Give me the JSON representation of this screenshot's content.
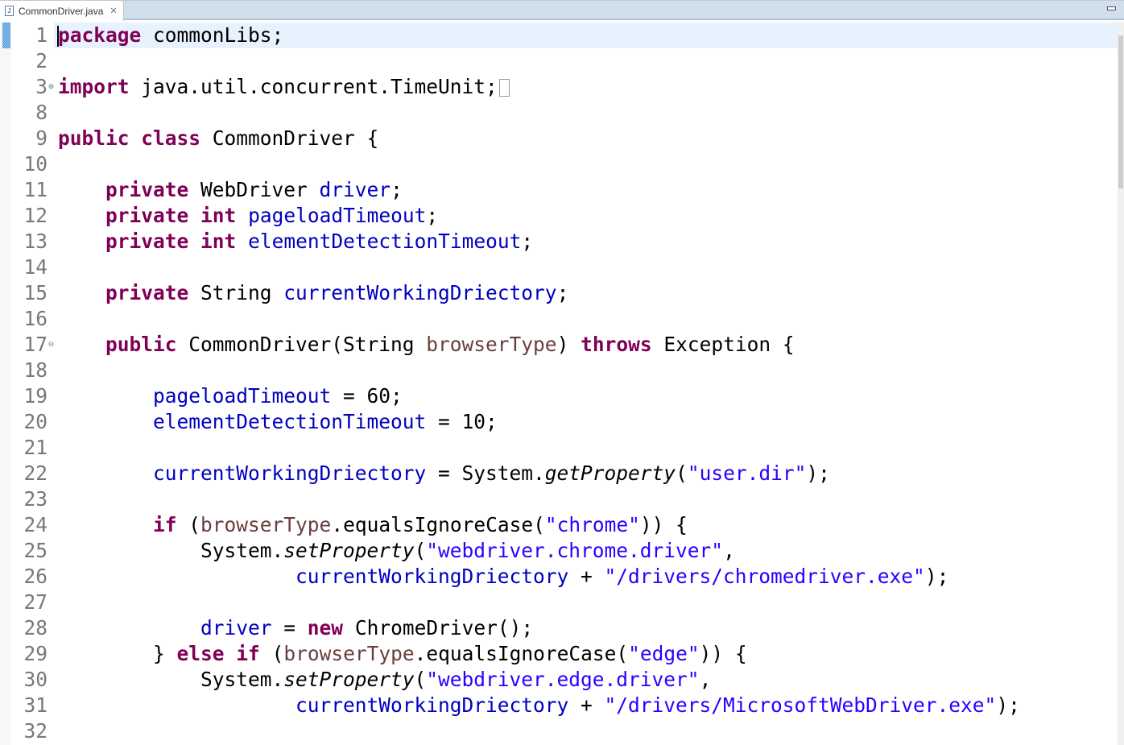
{
  "tab": {
    "title": "CommonDriver.java",
    "file_icon": "java-file-icon",
    "close_icon": "close-icon"
  },
  "editor": {
    "current_line": 1,
    "lines": [
      {
        "n": "1",
        "t": [
          [
            "package",
            "k"
          ],
          [
            " commonLibs;",
            "n"
          ]
        ]
      },
      {
        "n": "2",
        "t": []
      },
      {
        "n": "3",
        "fold": "+",
        "collapsed": true,
        "t": [
          [
            "import",
            "k"
          ],
          [
            " java.util.concurrent.TimeUnit;",
            "n"
          ]
        ]
      },
      {
        "n": "8",
        "t": []
      },
      {
        "n": "9",
        "t": [
          [
            "public",
            "k"
          ],
          [
            " ",
            "n"
          ],
          [
            "class",
            "k"
          ],
          [
            " CommonDriver {",
            "n"
          ]
        ]
      },
      {
        "n": "10",
        "t": []
      },
      {
        "n": "11",
        "t": [
          [
            "    ",
            "n"
          ],
          [
            "private",
            "k"
          ],
          [
            " WebDriver ",
            "n"
          ],
          [
            "driver",
            "f"
          ],
          [
            ";",
            "n"
          ]
        ]
      },
      {
        "n": "12",
        "t": [
          [
            "    ",
            "n"
          ],
          [
            "private",
            "k"
          ],
          [
            " ",
            "n"
          ],
          [
            "int",
            "k"
          ],
          [
            " ",
            "n"
          ],
          [
            "pageloadTimeout",
            "f"
          ],
          [
            ";",
            "n"
          ]
        ]
      },
      {
        "n": "13",
        "t": [
          [
            "    ",
            "n"
          ],
          [
            "private",
            "k"
          ],
          [
            " ",
            "n"
          ],
          [
            "int",
            "k"
          ],
          [
            " ",
            "n"
          ],
          [
            "elementDetectionTimeout",
            "f"
          ],
          [
            ";",
            "n"
          ]
        ]
      },
      {
        "n": "14",
        "t": []
      },
      {
        "n": "15",
        "t": [
          [
            "    ",
            "n"
          ],
          [
            "private",
            "k"
          ],
          [
            " String ",
            "n"
          ],
          [
            "currentWorkingDriectory",
            "f"
          ],
          [
            ";",
            "n"
          ]
        ]
      },
      {
        "n": "16",
        "t": []
      },
      {
        "n": "17",
        "fold": "-",
        "t": [
          [
            "    ",
            "n"
          ],
          [
            "public",
            "k"
          ],
          [
            " CommonDriver(String ",
            "n"
          ],
          [
            "browserType",
            "p"
          ],
          [
            ") ",
            "n"
          ],
          [
            "throws",
            "k"
          ],
          [
            " Exception {",
            "n"
          ]
        ]
      },
      {
        "n": "18",
        "t": []
      },
      {
        "n": "19",
        "t": [
          [
            "        ",
            "n"
          ],
          [
            "pageloadTimeout",
            "f"
          ],
          [
            " = 60;",
            "n"
          ]
        ]
      },
      {
        "n": "20",
        "t": [
          [
            "        ",
            "n"
          ],
          [
            "elementDetectionTimeout",
            "f"
          ],
          [
            " = 10;",
            "n"
          ]
        ]
      },
      {
        "n": "21",
        "t": []
      },
      {
        "n": "22",
        "t": [
          [
            "        ",
            "n"
          ],
          [
            "currentWorkingDriectory",
            "f"
          ],
          [
            " = System.",
            "n"
          ],
          [
            "getProperty",
            "i"
          ],
          [
            "(",
            "n"
          ],
          [
            "\"user.dir\"",
            "s"
          ],
          [
            ");",
            "n"
          ]
        ]
      },
      {
        "n": "23",
        "t": []
      },
      {
        "n": "24",
        "t": [
          [
            "        ",
            "n"
          ],
          [
            "if",
            "k"
          ],
          [
            " (",
            "n"
          ],
          [
            "browserType",
            "p"
          ],
          [
            ".equalsIgnoreCase(",
            "n"
          ],
          [
            "\"chrome\"",
            "s"
          ],
          [
            ")) {",
            "n"
          ]
        ]
      },
      {
        "n": "25",
        "t": [
          [
            "            System.",
            "n"
          ],
          [
            "setProperty",
            "i"
          ],
          [
            "(",
            "n"
          ],
          [
            "\"webdriver.chrome.driver\"",
            "s"
          ],
          [
            ",",
            "n"
          ]
        ]
      },
      {
        "n": "26",
        "t": [
          [
            "                    ",
            "n"
          ],
          [
            "currentWorkingDriectory",
            "f"
          ],
          [
            " + ",
            "n"
          ],
          [
            "\"/drivers/chromedriver.exe\"",
            "s"
          ],
          [
            ");",
            "n"
          ]
        ]
      },
      {
        "n": "27",
        "t": []
      },
      {
        "n": "28",
        "t": [
          [
            "            ",
            "n"
          ],
          [
            "driver",
            "f"
          ],
          [
            " = ",
            "n"
          ],
          [
            "new",
            "k"
          ],
          [
            " ChromeDriver();",
            "n"
          ]
        ]
      },
      {
        "n": "29",
        "t": [
          [
            "        } ",
            "n"
          ],
          [
            "else",
            "k"
          ],
          [
            " ",
            "n"
          ],
          [
            "if",
            "k"
          ],
          [
            " (",
            "n"
          ],
          [
            "browserType",
            "p"
          ],
          [
            ".equalsIgnoreCase(",
            "n"
          ],
          [
            "\"edge\"",
            "s"
          ],
          [
            ")) {",
            "n"
          ]
        ]
      },
      {
        "n": "30",
        "t": [
          [
            "            System.",
            "n"
          ],
          [
            "setProperty",
            "i"
          ],
          [
            "(",
            "n"
          ],
          [
            "\"webdriver.edge.driver\"",
            "s"
          ],
          [
            ",",
            "n"
          ]
        ]
      },
      {
        "n": "31",
        "t": [
          [
            "                    ",
            "n"
          ],
          [
            "currentWorkingDriectory",
            "f"
          ],
          [
            " + ",
            "n"
          ],
          [
            "\"/drivers/MicrosoftWebDriver.exe\"",
            "s"
          ],
          [
            ");",
            "n"
          ]
        ]
      },
      {
        "n": "32",
        "t": []
      }
    ]
  }
}
